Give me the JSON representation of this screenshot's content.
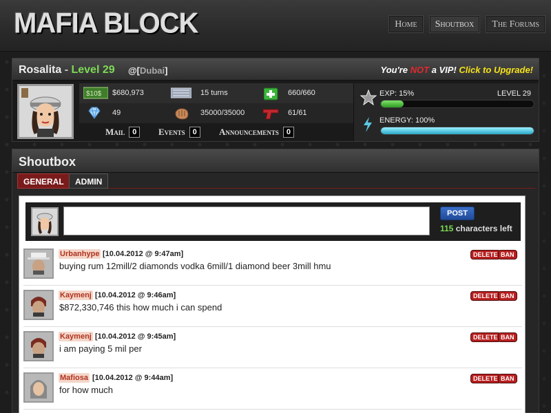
{
  "header": {
    "logo": "MAFIA BLOCK",
    "nav": [
      "Home",
      "Shoutbox",
      "The Forums"
    ]
  },
  "player": {
    "name": "Rosalita",
    "separator": " - ",
    "level_label": "Level 29",
    "location_prefix": "@[",
    "location": "Dubai",
    "location_suffix": "]",
    "vip": {
      "part1": "You're ",
      "not": "NOT",
      "part2": " a VIP! ",
      "upgrade": "Click to Upgrade!"
    },
    "stats": {
      "money_badge": "$10$",
      "money": "$680,973",
      "turns": "15 turns",
      "health": "660/660",
      "diamonds": "49",
      "strength": "35000/35000",
      "ammo": "61/61"
    },
    "counters": [
      {
        "label": "Mail",
        "value": "0"
      },
      {
        "label": "Events",
        "value": "0"
      },
      {
        "label": "Announcements",
        "value": "0"
      }
    ],
    "exp_label": "EXP: 15%",
    "exp_level": "LEVEL 29",
    "exp_percent": 15,
    "energy_label": "ENERGY: 100%",
    "energy_percent": 100
  },
  "shoutbox": {
    "title": "Shoutbox",
    "tabs": [
      "GENERAL",
      "ADMIN"
    ],
    "post_label": "POST",
    "chars_left_num": "115",
    "chars_left_text": " characters left",
    "delete_label": "DELETE",
    "ban_label": "BAN",
    "messages": [
      {
        "user": "Urbanhype",
        "time": "[10.04.2012 @ 9:47am]",
        "text": "buying rum 12mill/2 diamonds vodka 6mill/1 diamond beer 3mill hmu"
      },
      {
        "user": "Kaymenj",
        "time": "[10.04.2012 @ 9:46am]",
        "text": "$872,330,746 this how much i can spend"
      },
      {
        "user": "Kaymenj",
        "time": "[10.04.2012 @ 9:45am]",
        "text": "i am paying 5 mil per"
      },
      {
        "user": "Mafiosa",
        "time": "[10.04.2012 @ 9:44am]",
        "text": "for how much"
      }
    ]
  },
  "colors": {
    "level_green": "#7ddb55",
    "vip_red": "#e3282e",
    "vip_yellow": "#f6e21a",
    "exp_green": "#3fbf2f",
    "energy_cyan": "#4fc9e0",
    "tab_red": "#7a1b1b"
  }
}
